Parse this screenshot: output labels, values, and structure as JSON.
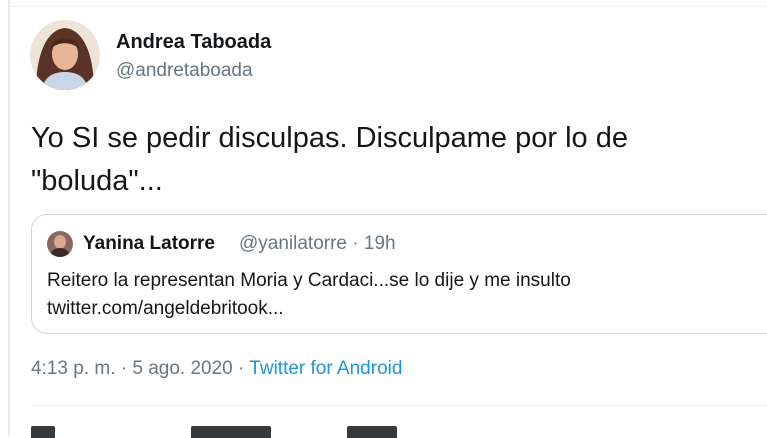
{
  "tweet": {
    "author_name": "Andrea Taboada",
    "author_handle": "@andretaboada",
    "text": "Yo SI se pedir disculpas. Disculpame por lo de \"boluda\"...",
    "timestamp": "4:13 p. m. · 5 ago. 2020",
    "separator": " · ",
    "source": "Twitter for Android"
  },
  "quoted_tweet": {
    "author_name": "Yanina Latorre",
    "author_handle": "@yanilatorre",
    "separator": " · ",
    "age": "19h",
    "text_line1": "Reitero la representan Moria y Cardaci...se lo dije y me insulto",
    "text_line2": "twitter.com/angeldebritook..."
  },
  "colors": {
    "secondary_text": "#657786",
    "link": "#1b95e0",
    "border": "#ccd6dd"
  }
}
